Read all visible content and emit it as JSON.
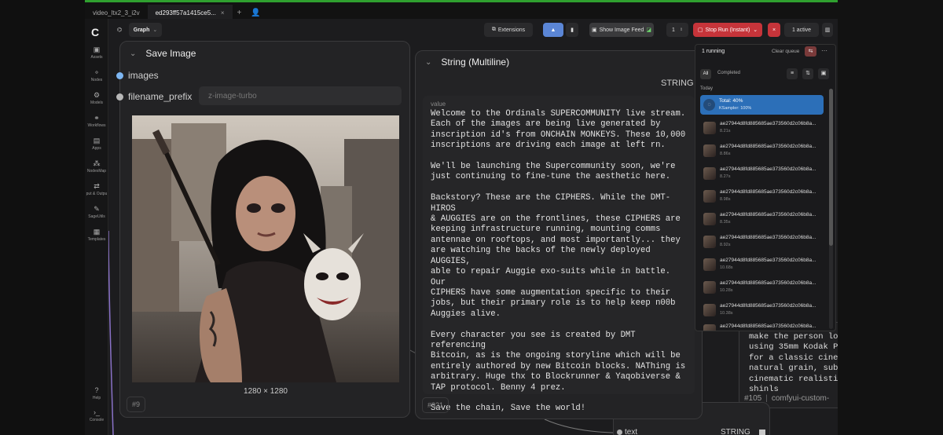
{
  "tabs": [
    "video_ltx2_3_i2v",
    "ed293ff57a1415ce5..."
  ],
  "tab_controls": [
    "+",
    "👤"
  ],
  "toolbar": {
    "graph_label": "Graph",
    "extensions_label": "Extensions",
    "show_image_feed_label": "Show Image Feed",
    "run_count": "1",
    "stop_run_label": "Stop Run (Instant)",
    "active_label": "1 active"
  },
  "sidebar": {
    "items": [
      {
        "label": "Assets",
        "icon": "assets-icon"
      },
      {
        "label": "Nodes",
        "icon": "nodes-icon"
      },
      {
        "label": "Models",
        "icon": "models-icon"
      },
      {
        "label": "Workflows",
        "icon": "workflows-icon"
      },
      {
        "label": "Apps",
        "icon": "apps-icon"
      },
      {
        "label": "NodesMap",
        "icon": "nodesmap-icon"
      },
      {
        "label": "put & Outpu",
        "icon": "io-icon"
      },
      {
        "label": "SageUtils",
        "icon": "sageutils-icon"
      },
      {
        "label": "Templates",
        "icon": "templates-icon"
      },
      {
        "label": "Help",
        "icon": "help-icon"
      },
      {
        "label": "Console",
        "icon": "console-icon"
      }
    ]
  },
  "save_node": {
    "title": "Save Image",
    "input_images": "images",
    "input_prefix_label": "filename_prefix",
    "input_prefix_value": "z-image-turbo",
    "image_size": "1280 × 1280",
    "node_id": "#9"
  },
  "string_node": {
    "title": "String (Multiline)",
    "output_label": "STRING",
    "value_label": "value",
    "text": "Welcome to the Ordinals SUPERCOMMUNITY live stream.\nEach of the images are being live generated by\ninscription id's from ONCHAIN MONKEYS. These 10,000\ninscriptions are driving each image at left rn.\n\nWe'll be launching the Supercommunity soon, we're\njust continuing to fine-tune the aesthetic here.\n\nBackstory? These are the CIPHERS. While the DMT-HIROS\n& AUGGIES are on the frontlines, these CIPHERS are\nkeeping infrastructure running, mounting comms\nantennae on rooftops, and most importantly... they\nare watching the backs of the newly deployed AUGGIES,\nable to repair Auggie exo-suits while in battle. Our\nCIPHERS have some augmentation specific to their\njobs, but their primary role is to help keep n00b\nAuggies alive.\n\nEvery character you see is created by DMT referencing\nBitcoin, as is the ongoing storyline which will be\nentirely authored by new Bitcoin blocks. NAThing is\narbitrary. Huge thx to Blockrunner & Yaqobiverse &\nTAP protocol. Benny 4 prez.\n\nSave the chain, Save the world!",
    "node_id": "#321"
  },
  "queue": {
    "running_label": "1 running",
    "clear_label": "Clear queue",
    "filter_all": "All",
    "filter_completed": "Completed",
    "section_today": "Today",
    "active_item": {
      "title": "Total: 40%",
      "sub": "KSampler: 100%"
    },
    "items": [
      {
        "name": "ae27944d8fd885685ae373560d2c06b8a...",
        "time": "8.21s"
      },
      {
        "name": "ae27944d8fd885685ae373560d2c06b8a...",
        "time": "8.86s"
      },
      {
        "name": "ae27944d8fd885685ae373560d2c06b8a...",
        "time": "8.27s"
      },
      {
        "name": "ae27944d8fd885685ae373560d2c06b8a...",
        "time": "8.98s"
      },
      {
        "name": "ae27944d8fd885685ae373560d2c06b8a...",
        "time": "8.35s"
      },
      {
        "name": "ae27944d8fd885685ae373560d2c06b8a...",
        "time": "8.92s"
      },
      {
        "name": "ae27944d8fd885685ae373560d2c06b8a...",
        "time": "10.68s"
      },
      {
        "name": "ae27944d8fd885685ae373560d2c06b8a...",
        "time": "10.28s"
      },
      {
        "name": "ae27944d8fd885685ae373560d2c06b8a...",
        "time": "10.38s"
      },
      {
        "name": "ae27944d8fd885685ae373560d2c06b8a...",
        "time": ""
      }
    ]
  },
  "bg_node": {
    "text": "make the person lo\nusing 35mm Kodak Po\nfor a classic ciner\nnatural grain, subt\ncinematic realistic\nshinls",
    "node_id": "#105",
    "node_name": "comfyui-custom-"
  },
  "bottom_node": {
    "input_label": "text",
    "output_label": "STRING"
  }
}
